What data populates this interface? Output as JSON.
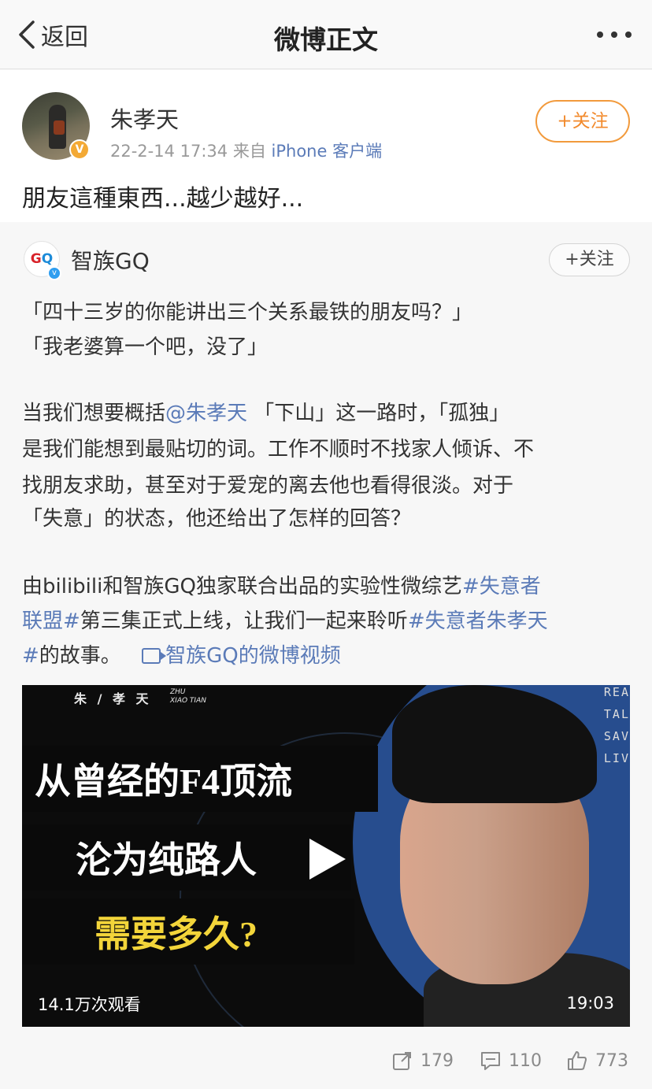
{
  "nav": {
    "back_label": "返回",
    "title": "微博正文"
  },
  "post": {
    "username": "朱孝天",
    "datetime": "22-2-14 17:34",
    "source_prefix": "来自",
    "source": "iPhone 客户端",
    "follow_label": "+关注",
    "text": "朋友這種東西...越少越好..."
  },
  "repost": {
    "account_name": "智族GQ",
    "follow_label": "+关注",
    "quote_line1": "「四十三岁的你能讲出三个关系最铁的朋友吗？」",
    "quote_line2": "「我老婆算一个吧，没了」",
    "para2": {
      "l1_pre": "当我们想要概括",
      "l1_mention": "@朱孝天",
      "l1_post": " 「下山」这一路时，「孤独」",
      "l2": "是我们能想到最贴切的词。工作不顺时不找家人倾诉、不",
      "l3": "找朋友求助，甚至对于爱宠的离去他也看得很淡。对于",
      "l4": "「失意」的状态，他还给出了怎样的回答？"
    },
    "para3": {
      "l1_pre": "由bilibili和智族GQ独家联合出品的实验性微综艺",
      "l1_tag": "#失意者",
      "l2_tag": "联盟#",
      "l2_mid": "第三集正式上线，让我们一起来聆听",
      "l2_tag2": "#失意者朱孝天",
      "l3_tag": "#",
      "l3_text": "的故事。",
      "video_link": "智族GQ的微博视频"
    }
  },
  "video": {
    "credit_cn": "朱 / 孝 天",
    "credit_en": "ZHU\nXIAO TIAN",
    "side_words": [
      "REA",
      "TAL",
      "SAV",
      "LIV"
    ],
    "banner1": "从曾经的F4顶流",
    "banner2": "沦为纯路人",
    "banner3": "需要多久?",
    "views": "14.1万次观看",
    "duration": "19:03"
  },
  "actions": {
    "reposts": "179",
    "comments": "110",
    "likes": "773"
  },
  "icons": [
    "chevron-left-icon",
    "more-icon",
    "verified-icon",
    "repost-icon",
    "comment-icon",
    "like-icon",
    "video-icon",
    "play-icon"
  ],
  "colors": {
    "accent_orange": "#f28a2c",
    "link_blue": "#5b7bb8",
    "highlight_yellow": "#f3d53a"
  }
}
